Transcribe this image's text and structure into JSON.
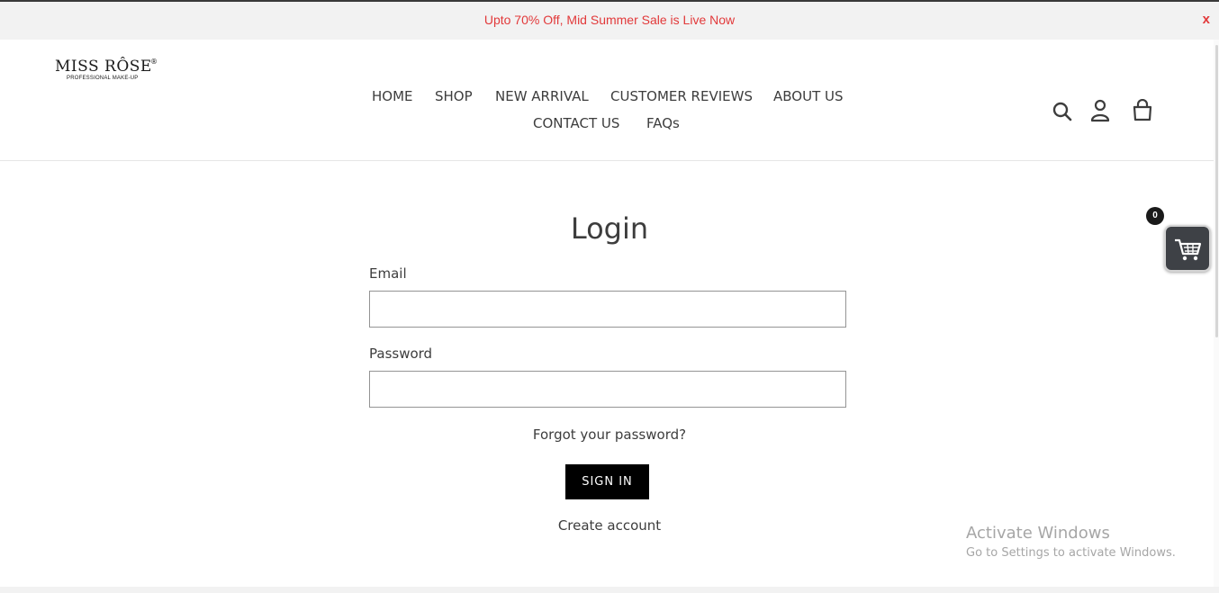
{
  "announcement": {
    "text": "Upto 70% Off, Mid Summer Sale is Live Now",
    "close_label": "x"
  },
  "logo": {
    "main": "MISS RÔSE",
    "registered": "®",
    "tagline": "PROFESSIONAL MAKE-UP"
  },
  "nav": {
    "items": [
      {
        "label": "HOME"
      },
      {
        "label": "SHOP"
      },
      {
        "label": "NEW ARRIVAL"
      },
      {
        "label": "CUSTOMER REVIEWS"
      },
      {
        "label": "ABOUT US"
      },
      {
        "label": "CONTACT US"
      },
      {
        "label": "FAQs"
      }
    ]
  },
  "header_icons": [
    "search-icon",
    "account-icon",
    "cart-icon"
  ],
  "login": {
    "title": "Login",
    "email_label": "Email",
    "email_value": "",
    "password_label": "Password",
    "password_value": "",
    "forgot_label": "Forgot your password?",
    "signin_label": "SIGN IN",
    "create_label": "Create account"
  },
  "floating_cart": {
    "count": "0",
    "icon": "shopping-cart-icon"
  },
  "watermark": {
    "title": "Activate Windows",
    "subtitle": "Go to Settings to activate Windows."
  },
  "colors": {
    "announcement_text": "#e2393a",
    "announcement_bg": "#f2f2f2",
    "button_bg": "#000000",
    "floating_cart_bg": "#3e4146"
  }
}
